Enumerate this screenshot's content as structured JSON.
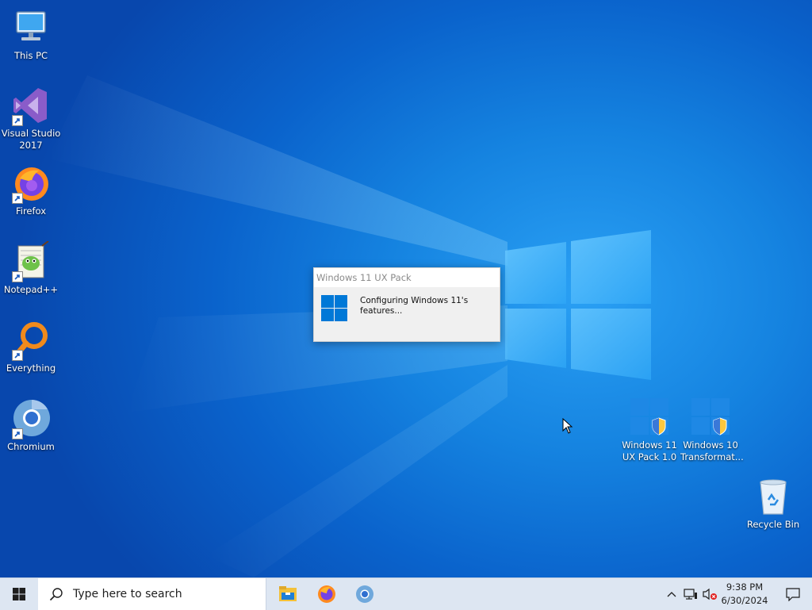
{
  "desktop": {
    "icons_left": [
      {
        "name": "this-pc",
        "label": "This PC"
      },
      {
        "name": "visual-studio-2017",
        "label": "Visual Studio 2017"
      },
      {
        "name": "firefox",
        "label": "Firefox"
      },
      {
        "name": "notepad-plus-plus",
        "label": "Notepad++"
      },
      {
        "name": "everything",
        "label": "Everything"
      },
      {
        "name": "chromium",
        "label": "Chromium"
      }
    ],
    "icons_right": [
      {
        "name": "windows-11-ux-pack",
        "label": "Windows 11 UX Pack 1.0"
      },
      {
        "name": "windows-10-transformation",
        "label": "Windows 10 Transformat..."
      },
      {
        "name": "recycle-bin",
        "label": "Recycle Bin"
      }
    ]
  },
  "dialog": {
    "title": "Windows 11 UX Pack",
    "message": "Configuring Windows 11's features..."
  },
  "taskbar": {
    "search_placeholder": "Type here to search",
    "pinned": [
      "File Explorer",
      "Firefox",
      "Chromium"
    ],
    "clock_time": "9:38 PM",
    "clock_date": "6/30/2024"
  },
  "colors": {
    "accent": "#0078d7",
    "taskbar": "#dde6f2"
  }
}
